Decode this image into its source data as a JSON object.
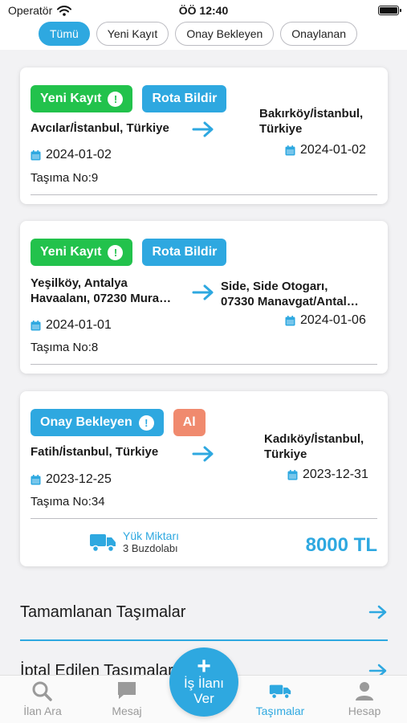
{
  "status_bar": {
    "carrier": "Operatör",
    "time": "ÖÖ 12:40"
  },
  "filters": [
    {
      "label": "Tümü",
      "active": true
    },
    {
      "label": "Yeni Kayıt",
      "active": false
    },
    {
      "label": "Onay Bekleyen",
      "active": false
    },
    {
      "label": "Onaylanan",
      "active": false
    }
  ],
  "cards": [
    {
      "status": "Yeni Kayıt",
      "action": "Rota Bildir",
      "from": [
        "Avcılar/İstanbul, Türkiye"
      ],
      "to": [
        "Bakırköy/İstanbul,",
        "Türkiye"
      ],
      "from_date": "2024-01-02",
      "to_date": "2024-01-02",
      "tasima_no": "Taşıma No:9"
    },
    {
      "status": "Yeni Kayıt",
      "action": "Rota Bildir",
      "from": [
        "Yeşilköy, Antalya",
        "Havaalanı, 07230 Mura…"
      ],
      "to": [
        "Side, Side Otogarı,",
        "07330 Manavgat/Antal…"
      ],
      "from_date": "2024-01-01",
      "to_date": "2024-01-06",
      "tasima_no": "Taşıma No:8"
    },
    {
      "status": "Onay Bekleyen",
      "action": "Al",
      "from": [
        "Fatih/İstanbul, Türkiye"
      ],
      "to": [
        "Kadıköy/İstanbul,",
        "Türkiye"
      ],
      "from_date": "2023-12-25",
      "to_date": "2023-12-31",
      "tasima_no": "Taşıma No:34",
      "load_title": "Yük Miktarı",
      "load_amount": "3 Buzdolabı",
      "price": "8000 TL"
    }
  ],
  "list": [
    {
      "label": "Tamamlanan Taşımalar"
    },
    {
      "label": "İptal Edilen Taşımalar"
    }
  ],
  "fab": {
    "label_line1": "İş İlanı",
    "label_line2": "Ver"
  },
  "nav": [
    {
      "label": "İlan Ara",
      "icon": "search-icon"
    },
    {
      "label": "Mesaj",
      "icon": "message-icon"
    },
    {
      "label": "Taşımalar",
      "icon": "truck-icon",
      "active": true
    },
    {
      "label": "Hesap",
      "icon": "user-icon"
    }
  ],
  "colors": {
    "accent": "#2ea8e0",
    "green": "#22c24c",
    "orange": "#f08a6e"
  }
}
